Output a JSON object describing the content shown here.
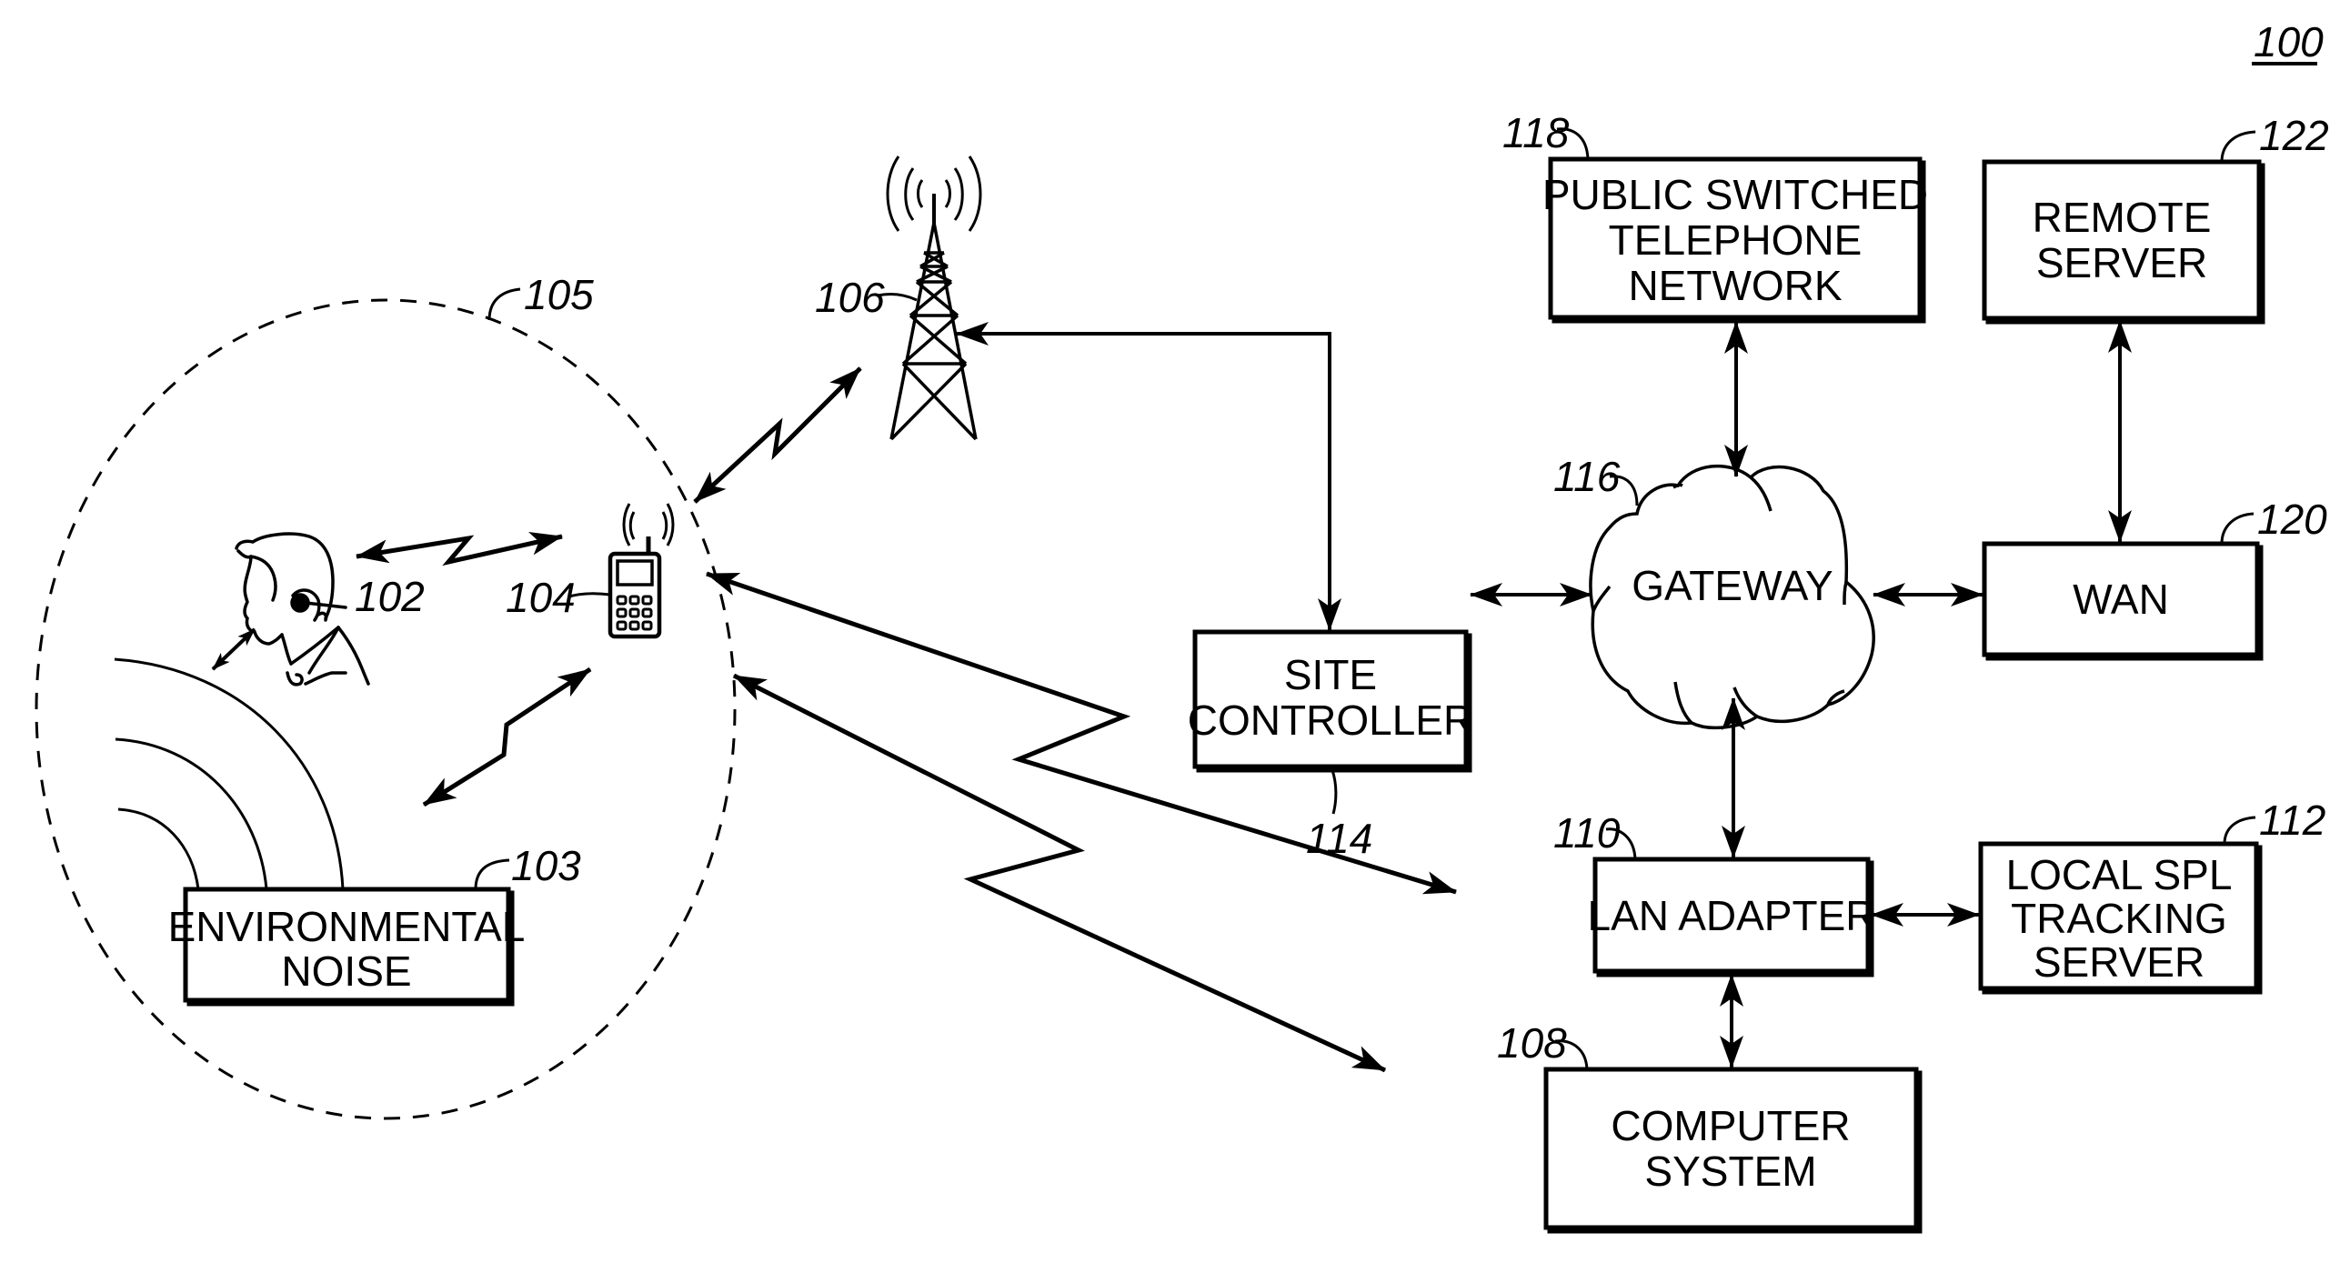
{
  "figure": {
    "number_label": "100",
    "ink_color": "#000000",
    "background_color": "#ffffff"
  },
  "elements": {
    "headset_user": {
      "ref": "102",
      "icon": "person-with-headset-icon"
    },
    "environmental_noise": {
      "ref": "103",
      "lines": [
        "ENVIRONMENTAL",
        "NOISE"
      ]
    },
    "mobile_device": {
      "ref": "104",
      "icon": "mobile-phone-icon"
    },
    "coverage_area": {
      "ref": "105"
    },
    "tower": {
      "ref": "106",
      "icon": "radio-tower-icon"
    },
    "computer_system": {
      "ref": "108",
      "lines": [
        "COMPUTER",
        "SYSTEM"
      ]
    },
    "lan_adapter": {
      "ref": "110",
      "lines": [
        "LAN ADAPTER"
      ]
    },
    "local_spl_server": {
      "ref": "112",
      "lines": [
        "LOCAL SPL",
        "TRACKING",
        "SERVER"
      ]
    },
    "site_controller": {
      "ref": "114",
      "lines": [
        "SITE",
        "CONTROLLER"
      ]
    },
    "gateway": {
      "ref": "116",
      "lines": [
        "GATEWAY"
      ]
    },
    "pstn": {
      "ref": "118",
      "lines": [
        "PUBLIC SWITCHED",
        "TELEPHONE",
        "NETWORK"
      ]
    },
    "wan": {
      "ref": "120",
      "lines": [
        "WAN"
      ]
    },
    "remote_server": {
      "ref": "122",
      "lines": [
        "REMOTE",
        "SERVER"
      ]
    }
  },
  "connections": [
    {
      "from": "headset_user",
      "to": "mobile_device",
      "type": "wireless",
      "bidirectional": true
    },
    {
      "from": "environmental_noise",
      "to": "mobile_device",
      "type": "wireless",
      "bidirectional": true
    },
    {
      "from": "mobile_device",
      "to": "tower",
      "type": "wireless",
      "bidirectional": true
    },
    {
      "from": "mobile_device",
      "to": "lan_adapter",
      "type": "wireless",
      "bidirectional": true
    },
    {
      "from": "mobile_device",
      "to": "computer_system",
      "type": "wireless",
      "bidirectional": true
    },
    {
      "from": "tower",
      "to": "site_controller",
      "type": "wired",
      "bidirectional": true
    },
    {
      "from": "site_controller",
      "to": "gateway",
      "type": "wired",
      "bidirectional": true
    },
    {
      "from": "gateway",
      "to": "pstn",
      "type": "wired",
      "bidirectional": true
    },
    {
      "from": "gateway",
      "to": "wan",
      "type": "wired",
      "bidirectional": true
    },
    {
      "from": "wan",
      "to": "remote_server",
      "type": "wired",
      "bidirectional": true
    },
    {
      "from": "gateway",
      "to": "lan_adapter",
      "type": "wired",
      "bidirectional": true
    },
    {
      "from": "lan_adapter",
      "to": "local_spl_server",
      "type": "wired",
      "bidirectional": true
    },
    {
      "from": "lan_adapter",
      "to": "computer_system",
      "type": "wired",
      "bidirectional": true
    }
  ]
}
